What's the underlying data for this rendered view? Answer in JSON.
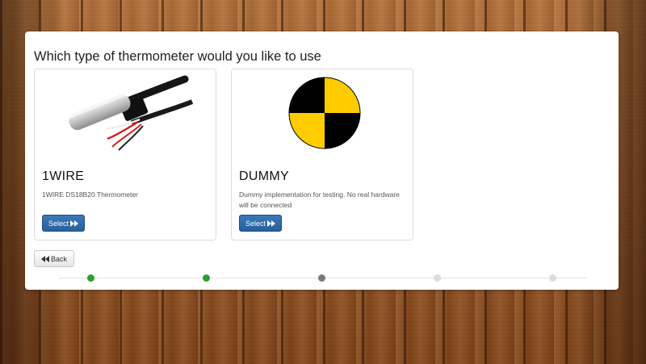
{
  "wizard": {
    "title": "Which type of thermometer would you like to use",
    "options": [
      {
        "name": "1WIRE",
        "description": "1WIRE DS18B20 Thermometer",
        "select_label": "Select",
        "image_icon": "ds18b20-probe-image"
      },
      {
        "name": "DUMMY",
        "description": "Dummy implementation for testing. No real hardware will be connected",
        "select_label": "Select",
        "image_icon": "calibration-target-image"
      }
    ],
    "back_label": "Back",
    "steps": [
      {
        "state": "done",
        "color": "#2e9e2e"
      },
      {
        "state": "done",
        "color": "#2e9e2e"
      },
      {
        "state": "current",
        "color": "#7a7a7a"
      },
      {
        "state": "todo",
        "color": "#dcdcdc"
      },
      {
        "state": "todo",
        "color": "#dcdcdc"
      }
    ],
    "colors": {
      "primary_button": "#2f6aa8",
      "target_yellow": "#ffcc00"
    }
  }
}
